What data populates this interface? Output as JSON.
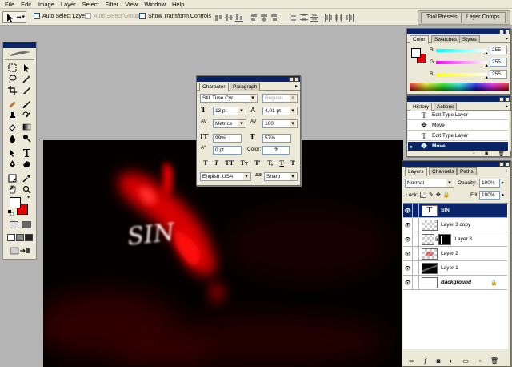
{
  "menu": [
    "File",
    "Edit",
    "Image",
    "Layer",
    "Select",
    "Filter",
    "View",
    "Window",
    "Help"
  ],
  "options": {
    "auto_select_layer": "Auto Select Layer",
    "auto_select_groups": "Auto Select Groups",
    "show_transform_controls": "Show Transform Controls"
  },
  "palette_well": {
    "tool_presets": "Tool Presets",
    "layer_comps": "Layer Comps"
  },
  "canvas": {
    "artwork_text": "SIN"
  },
  "color_panel": {
    "tabs": [
      "Color",
      "Swatches",
      "Styles"
    ],
    "sliders": [
      {
        "label": "R",
        "value": "255"
      },
      {
        "label": "G",
        "value": "255"
      },
      {
        "label": "B",
        "value": "255"
      }
    ],
    "foreground": "#ffffff",
    "background": "#e00000"
  },
  "history_panel": {
    "tabs": [
      "History",
      "Actions"
    ],
    "items": [
      {
        "label": "Edit Type Layer",
        "icon": "type-icon"
      },
      {
        "label": "Move",
        "icon": "move-icon"
      },
      {
        "label": "Edit Type Layer",
        "icon": "type-icon"
      },
      {
        "label": "Move",
        "icon": "move-icon",
        "selected": true
      }
    ]
  },
  "character_panel": {
    "tabs": [
      "Character",
      "Paragraph"
    ],
    "font_family": "Still Time Cyr",
    "font_style": "Regular",
    "font_size": "13 pt",
    "leading": "4,01 pt",
    "kerning": "Metrics",
    "tracking": "100",
    "vertical_scale": "99%",
    "horizontal_scale": "57%",
    "baseline_shift": "0 pt",
    "color_label": "Color:",
    "color_value": "?",
    "language": "English: USA",
    "antialias_label": "aa",
    "antialias": "Sharp",
    "style_buttons": [
      "T",
      "T",
      "TT",
      "Tт",
      "T'",
      "T,",
      "T",
      "T"
    ]
  },
  "layers_panel": {
    "tabs": [
      "Layers",
      "Channels",
      "Paths"
    ],
    "blend_mode": "Normal",
    "opacity_label": "Opacity:",
    "opacity": "100%",
    "lock_label": "Lock:",
    "fill_label": "Fill:",
    "fill": "100%",
    "layers": [
      {
        "name": "SIN",
        "type": "text",
        "selected": true
      },
      {
        "name": "Layer 3 copy",
        "type": "transparent"
      },
      {
        "name": "Layer 3",
        "type": "masked"
      },
      {
        "name": "Layer 2",
        "type": "transparent-red"
      },
      {
        "name": "Layer 1",
        "type": "dark"
      },
      {
        "name": "Background",
        "type": "background",
        "italic": true
      }
    ]
  },
  "colors": {
    "selection": "#0a246a",
    "accent_red": "#e00000",
    "ui_face": "#ece9d8"
  }
}
